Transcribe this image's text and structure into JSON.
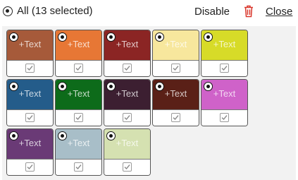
{
  "header": {
    "select_all_label": "All (13 selected)",
    "disable_label": "Disable",
    "delete_icon": "trash-icon",
    "close_label": "Close"
  },
  "colors": {
    "delete_icon": "#d9362b",
    "checkmark": "#8a8a8a"
  },
  "tiles": [
    {
      "label": "+Text",
      "color": "#a65a3a",
      "selected": true,
      "checked": true
    },
    {
      "label": "+Text",
      "color": "#e77735",
      "selected": true,
      "checked": true
    },
    {
      "label": "+Text",
      "color": "#8b2524",
      "selected": true,
      "checked": true
    },
    {
      "label": "+Text",
      "color": "#f7e79d",
      "selected": true,
      "checked": true
    },
    {
      "label": "+Text",
      "color": "#d7db28",
      "selected": true,
      "checked": true
    },
    {
      "label": "+Text",
      "color": "#245c8a",
      "selected": true,
      "checked": true
    },
    {
      "label": "+Text",
      "color": "#0d6b1a",
      "selected": true,
      "checked": true
    },
    {
      "label": "+Text",
      "color": "#3c1f31",
      "selected": true,
      "checked": true
    },
    {
      "label": "+Text",
      "color": "#5a2017",
      "selected": true,
      "checked": true
    },
    {
      "label": "+Text",
      "color": "#cf62c9",
      "selected": true,
      "checked": true
    },
    {
      "label": "+Text",
      "color": "#6a3a76",
      "selected": true,
      "checked": true
    },
    {
      "label": "+Text",
      "color": "#a8bec8",
      "selected": true,
      "checked": true
    },
    {
      "label": "+Text",
      "color": "#d5e1b1",
      "selected": true,
      "checked": true
    }
  ]
}
